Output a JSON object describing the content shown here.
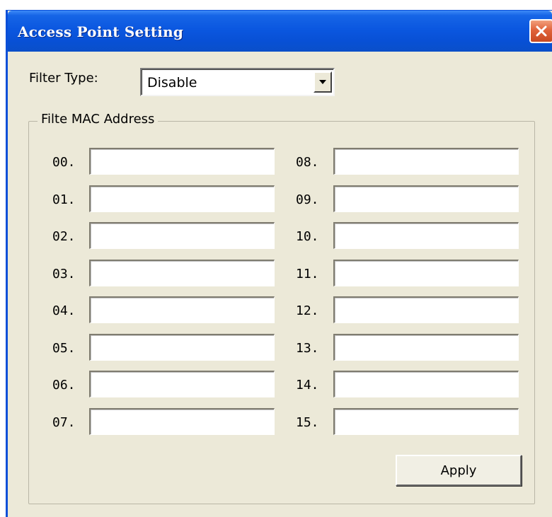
{
  "window": {
    "title": "Access Point Setting",
    "title_bar_color": "#0b57e0",
    "background_color": "#ece9d8"
  },
  "icons": {
    "close": "close-icon",
    "dropdown": "chevron-down-icon"
  },
  "filter": {
    "label": "Filter Type:",
    "selected": "Disable"
  },
  "group": {
    "legend": "Filte MAC Address"
  },
  "mac_entries": [
    {
      "label": "00.",
      "value": ""
    },
    {
      "label": "01.",
      "value": ""
    },
    {
      "label": "02.",
      "value": ""
    },
    {
      "label": "03.",
      "value": ""
    },
    {
      "label": "04.",
      "value": ""
    },
    {
      "label": "05.",
      "value": ""
    },
    {
      "label": "06.",
      "value": ""
    },
    {
      "label": "07.",
      "value": ""
    },
    {
      "label": "08.",
      "value": ""
    },
    {
      "label": "09.",
      "value": ""
    },
    {
      "label": "10.",
      "value": ""
    },
    {
      "label": "11.",
      "value": ""
    },
    {
      "label": "12.",
      "value": ""
    },
    {
      "label": "13.",
      "value": ""
    },
    {
      "label": "14.",
      "value": ""
    },
    {
      "label": "15.",
      "value": ""
    }
  ],
  "actions": {
    "apply_label": "Apply"
  }
}
